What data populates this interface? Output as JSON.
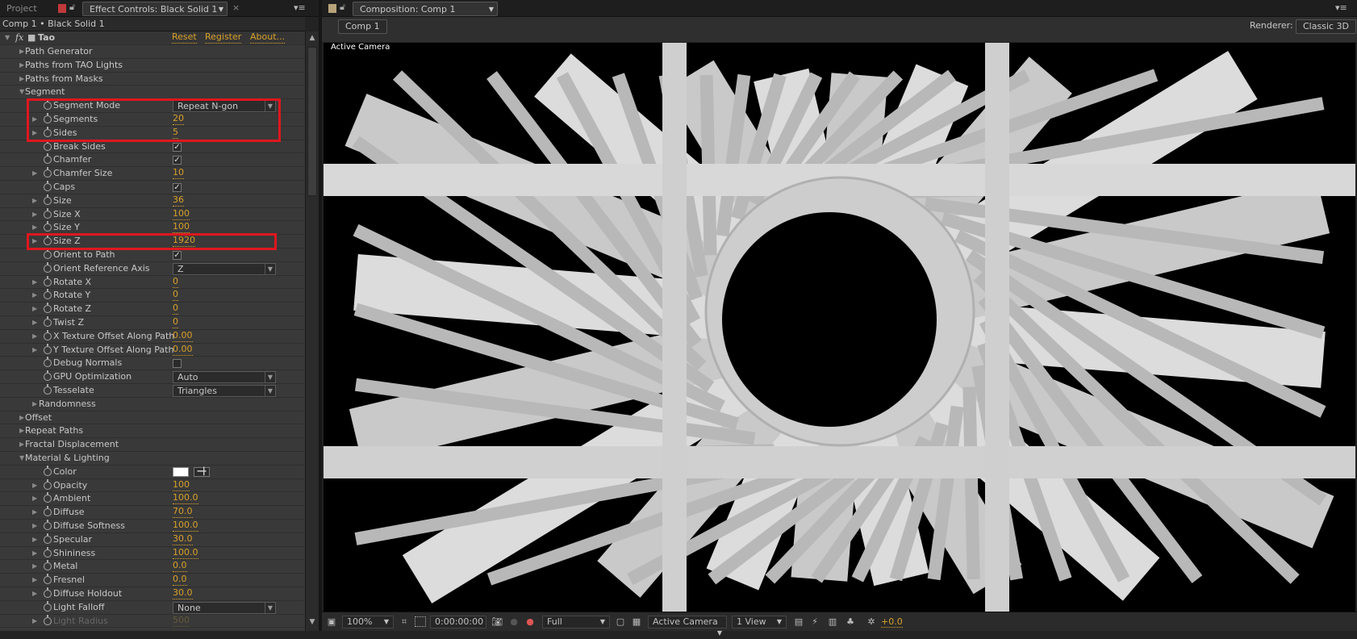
{
  "left_tabs": {
    "project": "Project",
    "effect_controls": "Effect Controls: Black Solid 1"
  },
  "breadcrumb": "Comp 1 • Black Solid 1",
  "effect": {
    "fx": "fx",
    "name": "Tao",
    "reset": "Reset",
    "register": "Register",
    "about": "About..."
  },
  "rows": [
    {
      "label": "Path Generator",
      "level": 1,
      "twirl": "closed"
    },
    {
      "label": "Paths from TAO Lights",
      "level": 1,
      "twirl": "closed"
    },
    {
      "label": "Paths from Masks",
      "level": 1,
      "twirl": "closed"
    },
    {
      "label": "Segment",
      "level": 1,
      "twirl": "open"
    },
    {
      "label": "Segment Mode",
      "level": 2,
      "twirl": "none",
      "dropdown": "Repeat N-gon"
    },
    {
      "label": "Segments",
      "level": 2,
      "twirl": "closed",
      "value": "20"
    },
    {
      "label": "Sides",
      "level": 2,
      "twirl": "closed",
      "value": "5"
    },
    {
      "label": "Break Sides",
      "level": 2,
      "twirl": "none",
      "checkbox": true
    },
    {
      "label": "Chamfer",
      "level": 2,
      "twirl": "none",
      "checkbox": true
    },
    {
      "label": "Chamfer Size",
      "level": 2,
      "twirl": "closed",
      "value": "10"
    },
    {
      "label": "Caps",
      "level": 2,
      "twirl": "none",
      "checkbox": true
    },
    {
      "label": "Size",
      "level": 2,
      "twirl": "closed",
      "value": "36"
    },
    {
      "label": "Size X",
      "level": 2,
      "twirl": "closed",
      "value": "100"
    },
    {
      "label": "Size Y",
      "level": 2,
      "twirl": "closed",
      "value": "100"
    },
    {
      "label": "Size Z",
      "level": 2,
      "twirl": "closed",
      "value": "1920"
    },
    {
      "label": "Orient to Path",
      "level": 2,
      "twirl": "none",
      "checkbox": true
    },
    {
      "label": "Orient Reference Axis",
      "level": 2,
      "twirl": "none",
      "dropdown": "Z"
    },
    {
      "label": "Rotate X",
      "level": 2,
      "twirl": "closed",
      "value": "0"
    },
    {
      "label": "Rotate Y",
      "level": 2,
      "twirl": "closed",
      "value": "0"
    },
    {
      "label": "Rotate Z",
      "level": 2,
      "twirl": "closed",
      "value": "0"
    },
    {
      "label": "Twist Z",
      "level": 2,
      "twirl": "closed",
      "value": "0"
    },
    {
      "label": "X Texture Offset Along Path",
      "level": 2,
      "twirl": "closed",
      "value": "0.00"
    },
    {
      "label": "Y Texture Offset Along Path",
      "level": 2,
      "twirl": "closed",
      "value": "0.00"
    },
    {
      "label": "Debug Normals",
      "level": 2,
      "twirl": "none",
      "checkbox": false
    },
    {
      "label": "GPU Optimization",
      "level": 2,
      "twirl": "none",
      "dropdown": "Auto"
    },
    {
      "label": "Tesselate",
      "level": 2,
      "twirl": "none",
      "dropdown": "Triangles"
    },
    {
      "label": "Randomness",
      "level": 3,
      "twirl": "closed"
    },
    {
      "label": "Offset",
      "level": 1,
      "twirl": "closed"
    },
    {
      "label": "Repeat Paths",
      "level": 1,
      "twirl": "closed"
    },
    {
      "label": "Fractal Displacement",
      "level": 1,
      "twirl": "closed"
    },
    {
      "label": "Material & Lighting",
      "level": 1,
      "twirl": "open"
    },
    {
      "label": "Color",
      "level": 2,
      "twirl": "none",
      "color": "#ffffff"
    },
    {
      "label": "Opacity",
      "level": 2,
      "twirl": "closed",
      "value": "100"
    },
    {
      "label": "Ambient",
      "level": 2,
      "twirl": "closed",
      "value": "100.0"
    },
    {
      "label": "Diffuse",
      "level": 2,
      "twirl": "closed",
      "value": "70.0"
    },
    {
      "label": "Diffuse Softness",
      "level": 2,
      "twirl": "closed",
      "value": "100.0"
    },
    {
      "label": "Specular",
      "level": 2,
      "twirl": "closed",
      "value": "30.0"
    },
    {
      "label": "Shininess",
      "level": 2,
      "twirl": "closed",
      "value": "100.0"
    },
    {
      "label": "Metal",
      "level": 2,
      "twirl": "closed",
      "value": "0.0"
    },
    {
      "label": "Fresnel",
      "level": 2,
      "twirl": "closed",
      "value": "0.0"
    },
    {
      "label": "Diffuse Holdout",
      "level": 2,
      "twirl": "closed",
      "value": "30.0"
    },
    {
      "label": "Light Falloff",
      "level": 2,
      "twirl": "none",
      "dropdown": "None"
    },
    {
      "label": "Light Radius",
      "level": 2,
      "twirl": "closed",
      "value": "500",
      "dim": true
    }
  ],
  "comp": {
    "tab": "Composition: Comp 1",
    "comp_button": "Comp 1",
    "renderer_label": "Renderer:",
    "renderer": "Classic 3D",
    "viewer_label": "Active Camera"
  },
  "toolbar": {
    "zoom": "100%",
    "timecode": "0:00:00:00",
    "resolution": "Full",
    "camera": "Active Camera",
    "views": "1 View",
    "exposure": "+0.0"
  },
  "colors": {
    "highlight": "#e0161e",
    "accent": "#d9a12a"
  }
}
